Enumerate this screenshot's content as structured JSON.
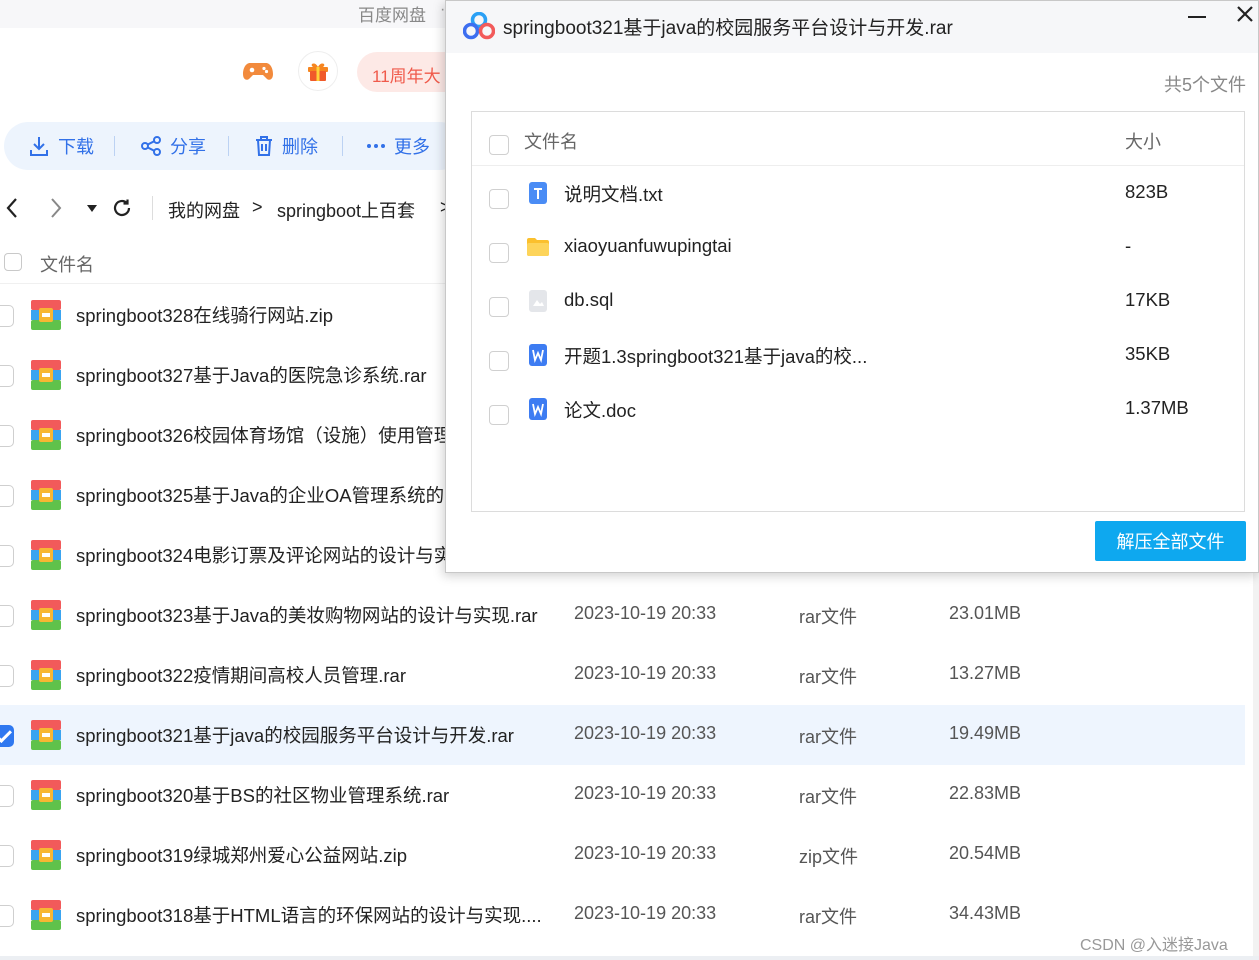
{
  "app": {
    "title": "百度网盘",
    "title_suffix": "·"
  },
  "promo": {
    "label": "11周年大"
  },
  "toolbar": {
    "download": "下载",
    "share": "分享",
    "delete": "删除",
    "more": "更多"
  },
  "breadcrumb": {
    "root": "我的网盘",
    "folder": "springboot上百套",
    "sep": ">"
  },
  "list": {
    "header_name": "文件名",
    "rows": [
      {
        "name": "springboot328在线骑行网站.zip",
        "date": "",
        "type": "",
        "size": "",
        "checked": false
      },
      {
        "name": "springboot327基于Java的医院急诊系统.rar",
        "date": "",
        "type": "",
        "size": "",
        "checked": false
      },
      {
        "name": "springboot326校园体育场馆（设施）使用管理",
        "date": "",
        "type": "",
        "size": "",
        "checked": false
      },
      {
        "name": "springboot325基于Java的企业OA管理系统的",
        "date": "",
        "type": "",
        "size": "",
        "checked": false
      },
      {
        "name": "springboot324电影订票及评论网站的设计与实",
        "date": "",
        "type": "",
        "size": "",
        "checked": false
      },
      {
        "name": "springboot323基于Java的美妆购物网站的设计与实现.rar",
        "date": "2023-10-19 20:33",
        "type": "rar文件",
        "size": "23.01MB",
        "checked": false
      },
      {
        "name": "springboot322疫情期间高校人员管理.rar",
        "date": "2023-10-19 20:33",
        "type": "rar文件",
        "size": "13.27MB",
        "checked": false
      },
      {
        "name": "springboot321基于java的校园服务平台设计与开发.rar",
        "date": "2023-10-19 20:33",
        "type": "rar文件",
        "size": "19.49MB",
        "checked": true
      },
      {
        "name": "springboot320基于BS的社区物业管理系统.rar",
        "date": "2023-10-19 20:33",
        "type": "rar文件",
        "size": "22.83MB",
        "checked": false
      },
      {
        "name": "springboot319绿城郑州爱心公益网站.zip",
        "date": "2023-10-19 20:33",
        "type": "zip文件",
        "size": "20.54MB",
        "checked": false
      },
      {
        "name": "springboot318基于HTML语言的环保网站的设计与实现....",
        "date": "2023-10-19 20:33",
        "type": "rar文件",
        "size": "34.43MB",
        "checked": false
      }
    ]
  },
  "dialog": {
    "title": "springboot321基于java的校园服务平台设计与开发.rar",
    "count": "共5个文件",
    "header_name": "文件名",
    "header_size": "大小",
    "files": [
      {
        "name": "说明文档.txt",
        "size": "823B",
        "icon": "txt-file-icon"
      },
      {
        "name": "xiaoyuanfuwupingtai",
        "size": "-",
        "icon": "folder-icon"
      },
      {
        "name": "db.sql",
        "size": "17KB",
        "icon": "generic-file-icon"
      },
      {
        "name": "开题1.3springboot321基于java的校...",
        "size": "35KB",
        "icon": "word-file-icon"
      },
      {
        "name": "论文.doc",
        "size": "1.37MB",
        "icon": "word-file-icon"
      }
    ],
    "extract_button": "解压全部文件"
  },
  "watermark": "CSDN @入迷接Java",
  "colors": {
    "accent": "#3271e8",
    "extract_button": "#0ea8ef",
    "promo_text": "#f05a4b",
    "selected_row": "#eef5fe"
  }
}
